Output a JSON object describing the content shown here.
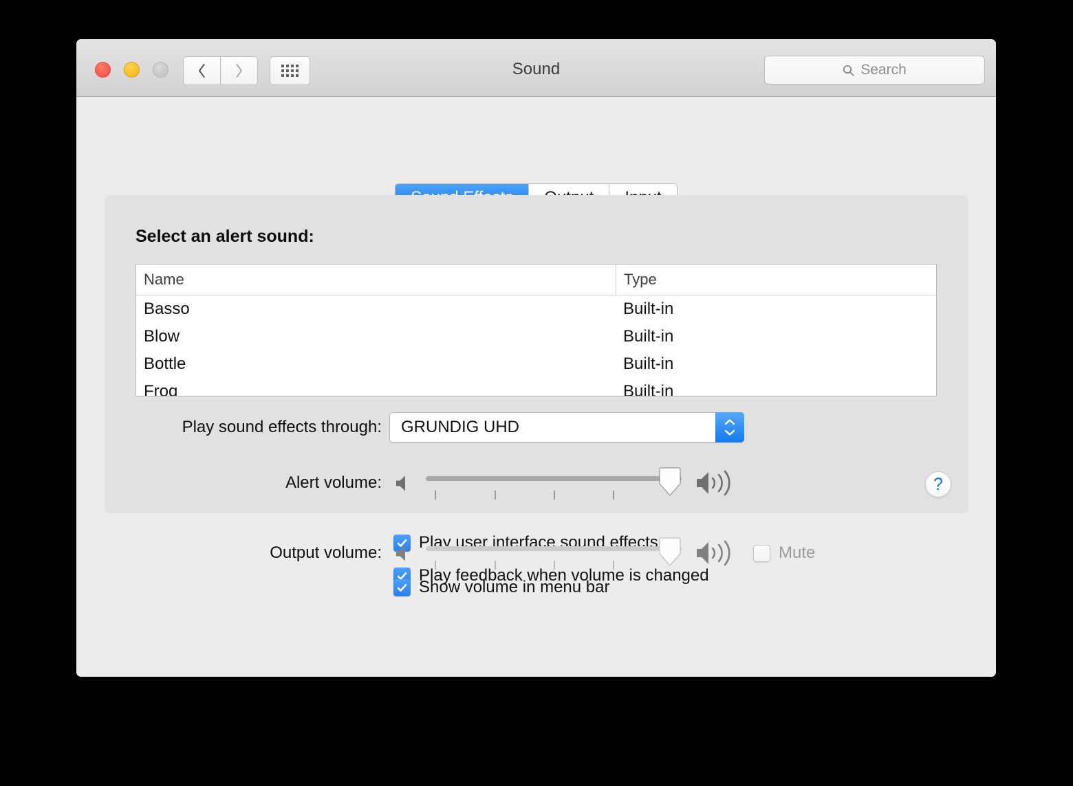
{
  "window": {
    "title": "Sound",
    "traffic_lights": [
      "close",
      "minimize",
      "zoom"
    ],
    "nav_back_label": "Back",
    "nav_forward_label": "Forward",
    "grid_label": "Show All"
  },
  "search": {
    "placeholder": "Search",
    "value": "",
    "icon": "search-icon"
  },
  "tabs": [
    {
      "label": "Sound Effects",
      "active": true
    },
    {
      "label": "Output",
      "active": false
    },
    {
      "label": "Input",
      "active": false
    }
  ],
  "sound_effects": {
    "section_title": "Select an alert sound:",
    "table": {
      "columns": [
        "Name",
        "Type"
      ],
      "rows": [
        {
          "name": "Basso",
          "type": "Built-in"
        },
        {
          "name": "Blow",
          "type": "Built-in"
        },
        {
          "name": "Bottle",
          "type": "Built-in"
        },
        {
          "name": "Frog",
          "type": "Built-in"
        }
      ]
    },
    "output_device": {
      "label": "Play sound effects through:",
      "value": "GRUNDIG UHD"
    },
    "alert_volume": {
      "label": "Alert volume:",
      "value": 95,
      "min": 0,
      "max": 100,
      "tick_count": 4,
      "mute_icon": "speaker-mute-icon",
      "max_icon": "speaker-loud-icon"
    },
    "checkboxes": [
      {
        "label": "Play user interface sound effects",
        "checked": true
      },
      {
        "label": "Play feedback when volume is changed",
        "checked": true
      }
    ],
    "help_label": "?"
  },
  "output": {
    "volume": {
      "label": "Output volume:",
      "value": 95,
      "min": 0,
      "max": 100,
      "tick_count": 4,
      "disabled": true,
      "mute_icon": "speaker-mute-icon",
      "max_icon": "speaker-loud-icon"
    },
    "mute": {
      "label": "Mute",
      "checked": false
    },
    "show_in_menu_bar": {
      "label": "Show volume in menu bar",
      "checked": true
    }
  },
  "colors": {
    "accent_blue": "#1479ec",
    "checkbox_blue": "#2a7ff0",
    "help_blue": "#0a72e8",
    "window_bg": "#ececec",
    "panel_bg": "#e1e1e1"
  }
}
